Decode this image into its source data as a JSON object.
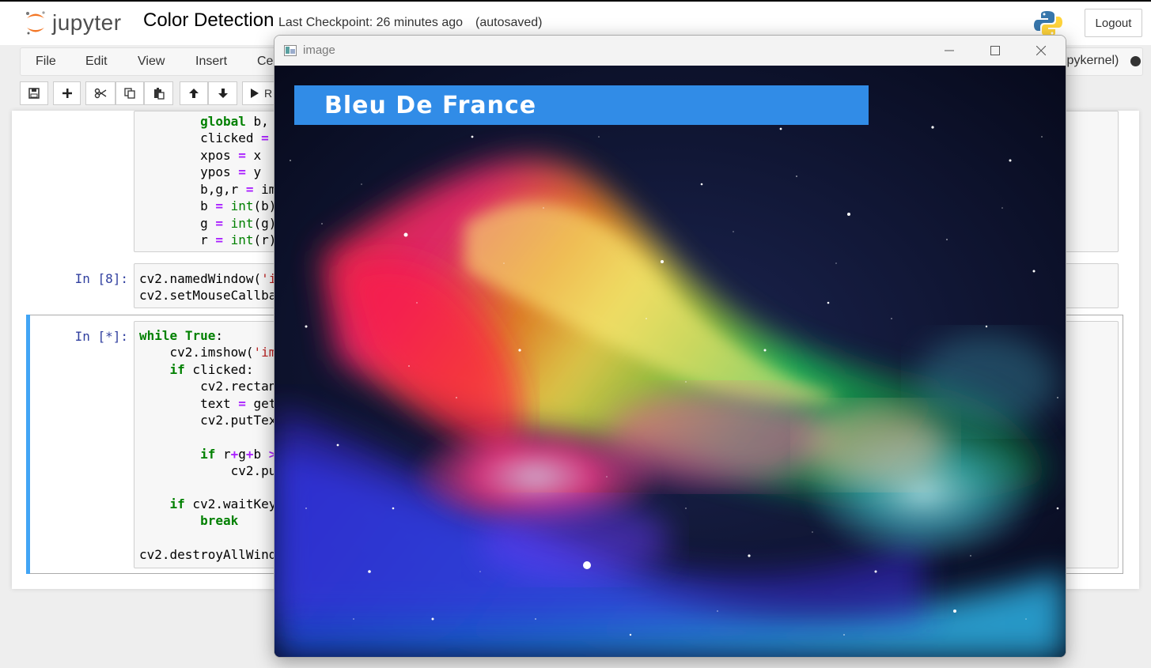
{
  "header": {
    "logo_text": "jupyter",
    "notebook_title": "Color Detection",
    "checkpoint": "Last Checkpoint: 26 minutes ago",
    "autosave": "(autosaved)",
    "logout_label": "Logout"
  },
  "menubar": {
    "items": [
      "File",
      "Edit",
      "View",
      "Insert",
      "Ce"
    ],
    "kernel": "ipykernel)"
  },
  "toolbar": {
    "run_label": "R"
  },
  "cells": {
    "prompt_8": "In [8]:",
    "prompt_star": "In [*]:"
  },
  "image_window": {
    "title": "image",
    "color_name": "Bleu De France",
    "banner_color": "#318ce7"
  }
}
